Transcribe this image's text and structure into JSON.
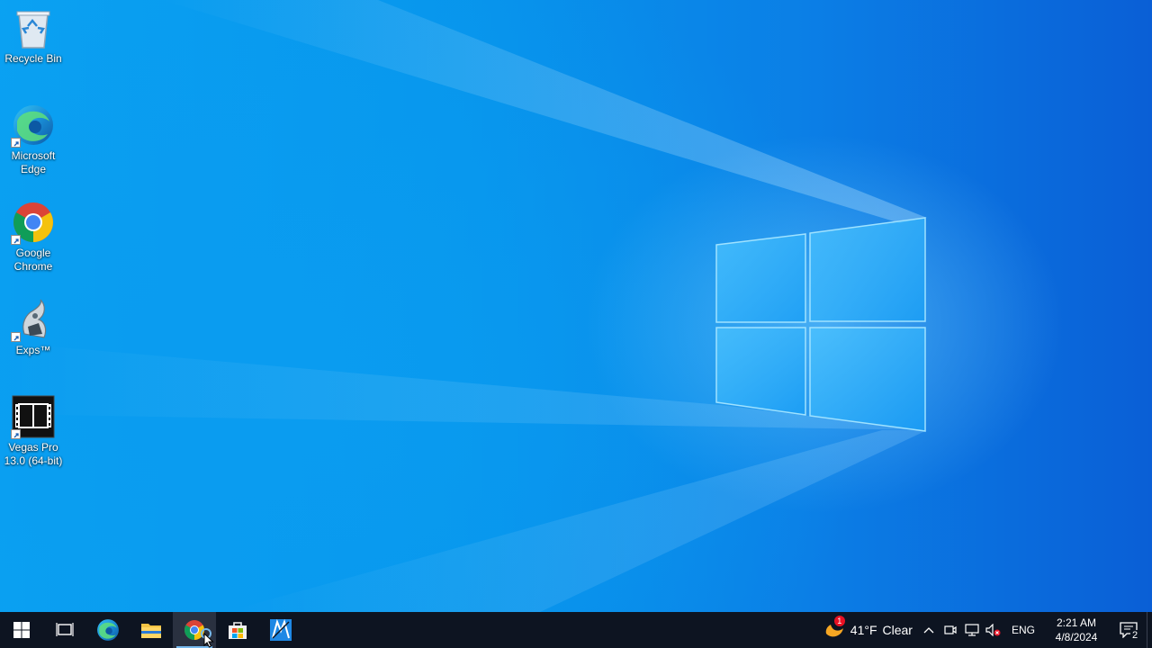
{
  "desktop": {
    "icons": [
      {
        "label": "Recycle Bin",
        "icon": "recycle-bin-icon"
      },
      {
        "label": "Microsoft Edge",
        "icon": "edge-icon"
      },
      {
        "label": "Google Chrome",
        "icon": "chrome-icon"
      },
      {
        "label": "Exps™",
        "icon": "exps-icon"
      },
      {
        "label": "Vegas Pro 13.0 (64-bit)",
        "icon": "vegas-pro-icon"
      }
    ]
  },
  "taskbar": {
    "pinned": [
      {
        "name": "start",
        "icon": "windows-start-icon"
      },
      {
        "name": "task-view",
        "icon": "task-view-icon"
      },
      {
        "name": "edge",
        "icon": "edge-icon"
      },
      {
        "name": "file-explorer",
        "icon": "folder-icon"
      },
      {
        "name": "chrome",
        "icon": "chrome-icon"
      },
      {
        "name": "microsoft-store",
        "icon": "store-icon"
      },
      {
        "name": "app",
        "icon": "app-icon"
      }
    ],
    "weather": {
      "temp": "41°F",
      "condition": "Clear",
      "alert_count": "1"
    },
    "language": "ENG",
    "time": "2:21 AM",
    "date": "4/8/2024",
    "notification_count": "2"
  },
  "colors": {
    "desktop_base": "#0795ec",
    "taskbar_bg": "#0d1421",
    "accent": "#76b9ed"
  }
}
